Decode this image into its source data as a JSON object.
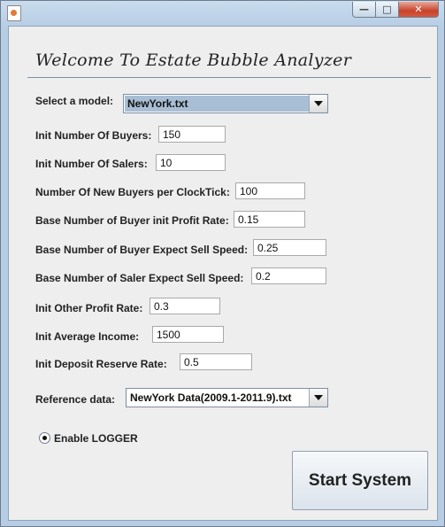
{
  "window": {
    "title": "",
    "buttons": {
      "minimize": "—",
      "maximize": "□",
      "close": "✕"
    }
  },
  "heading": "Welcome To Estate Bubble Analyzer",
  "model": {
    "label": "Select a model:",
    "value": "NewYork.txt"
  },
  "fields": [
    {
      "label": "Init Number Of Buyers:",
      "value": "150"
    },
    {
      "label": "Init Number Of Salers:",
      "value": "10"
    },
    {
      "label": "Number Of New Buyers per ClockTick:",
      "value": "100"
    },
    {
      "label": "Base Number of Buyer init Profit Rate:",
      "value": "0.15"
    },
    {
      "label": "Base Number of Buyer Expect Sell Speed:",
      "value": "0.25"
    },
    {
      "label": "Base Number of Saler Expect Sell Speed:",
      "value": "0.2"
    },
    {
      "label": "Init Other Profit Rate:",
      "value": "0.3"
    },
    {
      "label": "Init Average Income:",
      "value": "1500"
    },
    {
      "label": "Init Deposit Reserve Rate:",
      "value": "0.5"
    }
  ],
  "reference": {
    "label": "Reference data:",
    "value": "NewYork Data(2009.1-2011.9).txt"
  },
  "logger": {
    "label": "Enable LOGGER",
    "selected": true
  },
  "start_button": "Start System"
}
